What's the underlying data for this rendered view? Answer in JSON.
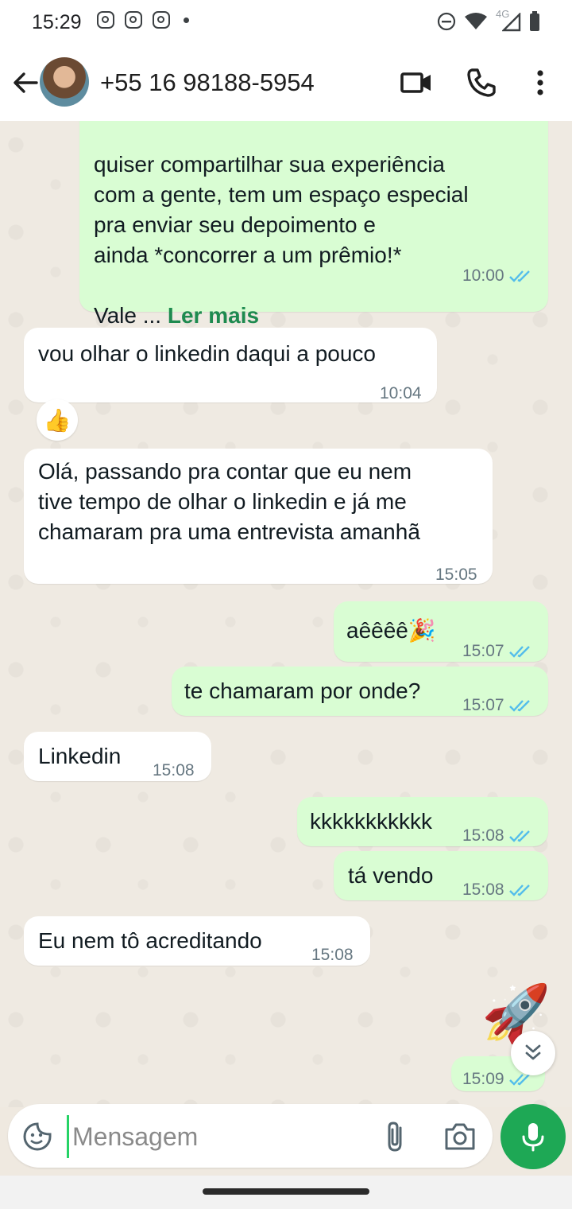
{
  "status_bar": {
    "time": "15:29",
    "network": "4G"
  },
  "header": {
    "contact": "+55 16 98188-5954"
  },
  "messages": [
    {
      "dir": "out",
      "text": "quiser compartilhar sua experiência\ncom a gente, tem um espaço especial\npra enviar seu depoimento e\nainda *concorrer a um prêmio!*\n\nVale ...",
      "read_more": "Ler mais",
      "time": "10:00",
      "ticks": "read"
    },
    {
      "dir": "in",
      "text": "vou olhar o linkedin daqui a pouco",
      "time": "10:04",
      "reaction": "👍"
    },
    {
      "dir": "in",
      "text": "Olá, passando pra contar que eu nem\ntive tempo de olhar o linkedin e já me\nchamaram pra uma entrevista amanhã",
      "time": "15:05"
    },
    {
      "dir": "out",
      "text": "aêêêê🎉",
      "time": "15:07",
      "ticks": "read"
    },
    {
      "dir": "out",
      "text": "te chamaram por onde?",
      "time": "15:07",
      "ticks": "read"
    },
    {
      "dir": "in",
      "text": "Linkedin",
      "time": "15:08"
    },
    {
      "dir": "out",
      "text": "kkkkkkkkkkk",
      "time": "15:08",
      "ticks": "read"
    },
    {
      "dir": "out",
      "text": "tá vendo",
      "time": "15:08",
      "ticks": "read"
    },
    {
      "dir": "in",
      "text": "Eu nem tô acreditando",
      "time": "15:08"
    },
    {
      "dir": "out",
      "sticker": "🚀",
      "time": "15:09",
      "ticks": "read"
    }
  ],
  "composer": {
    "placeholder": "Mensagem"
  },
  "icons": {
    "back": "arrow-left-icon",
    "video": "video-call-icon",
    "call": "phone-icon",
    "menu": "more-vert-icon",
    "emoji": "sticker-smiley-icon",
    "attach": "paperclip-icon",
    "camera": "camera-icon",
    "mic": "microphone-icon",
    "scroll": "double-chevron-down-icon"
  },
  "colors": {
    "accent": "#1ea855",
    "outgoing": "#d9fdd3",
    "incoming": "#ffffff",
    "read_ticks": "#53bdeb"
  }
}
